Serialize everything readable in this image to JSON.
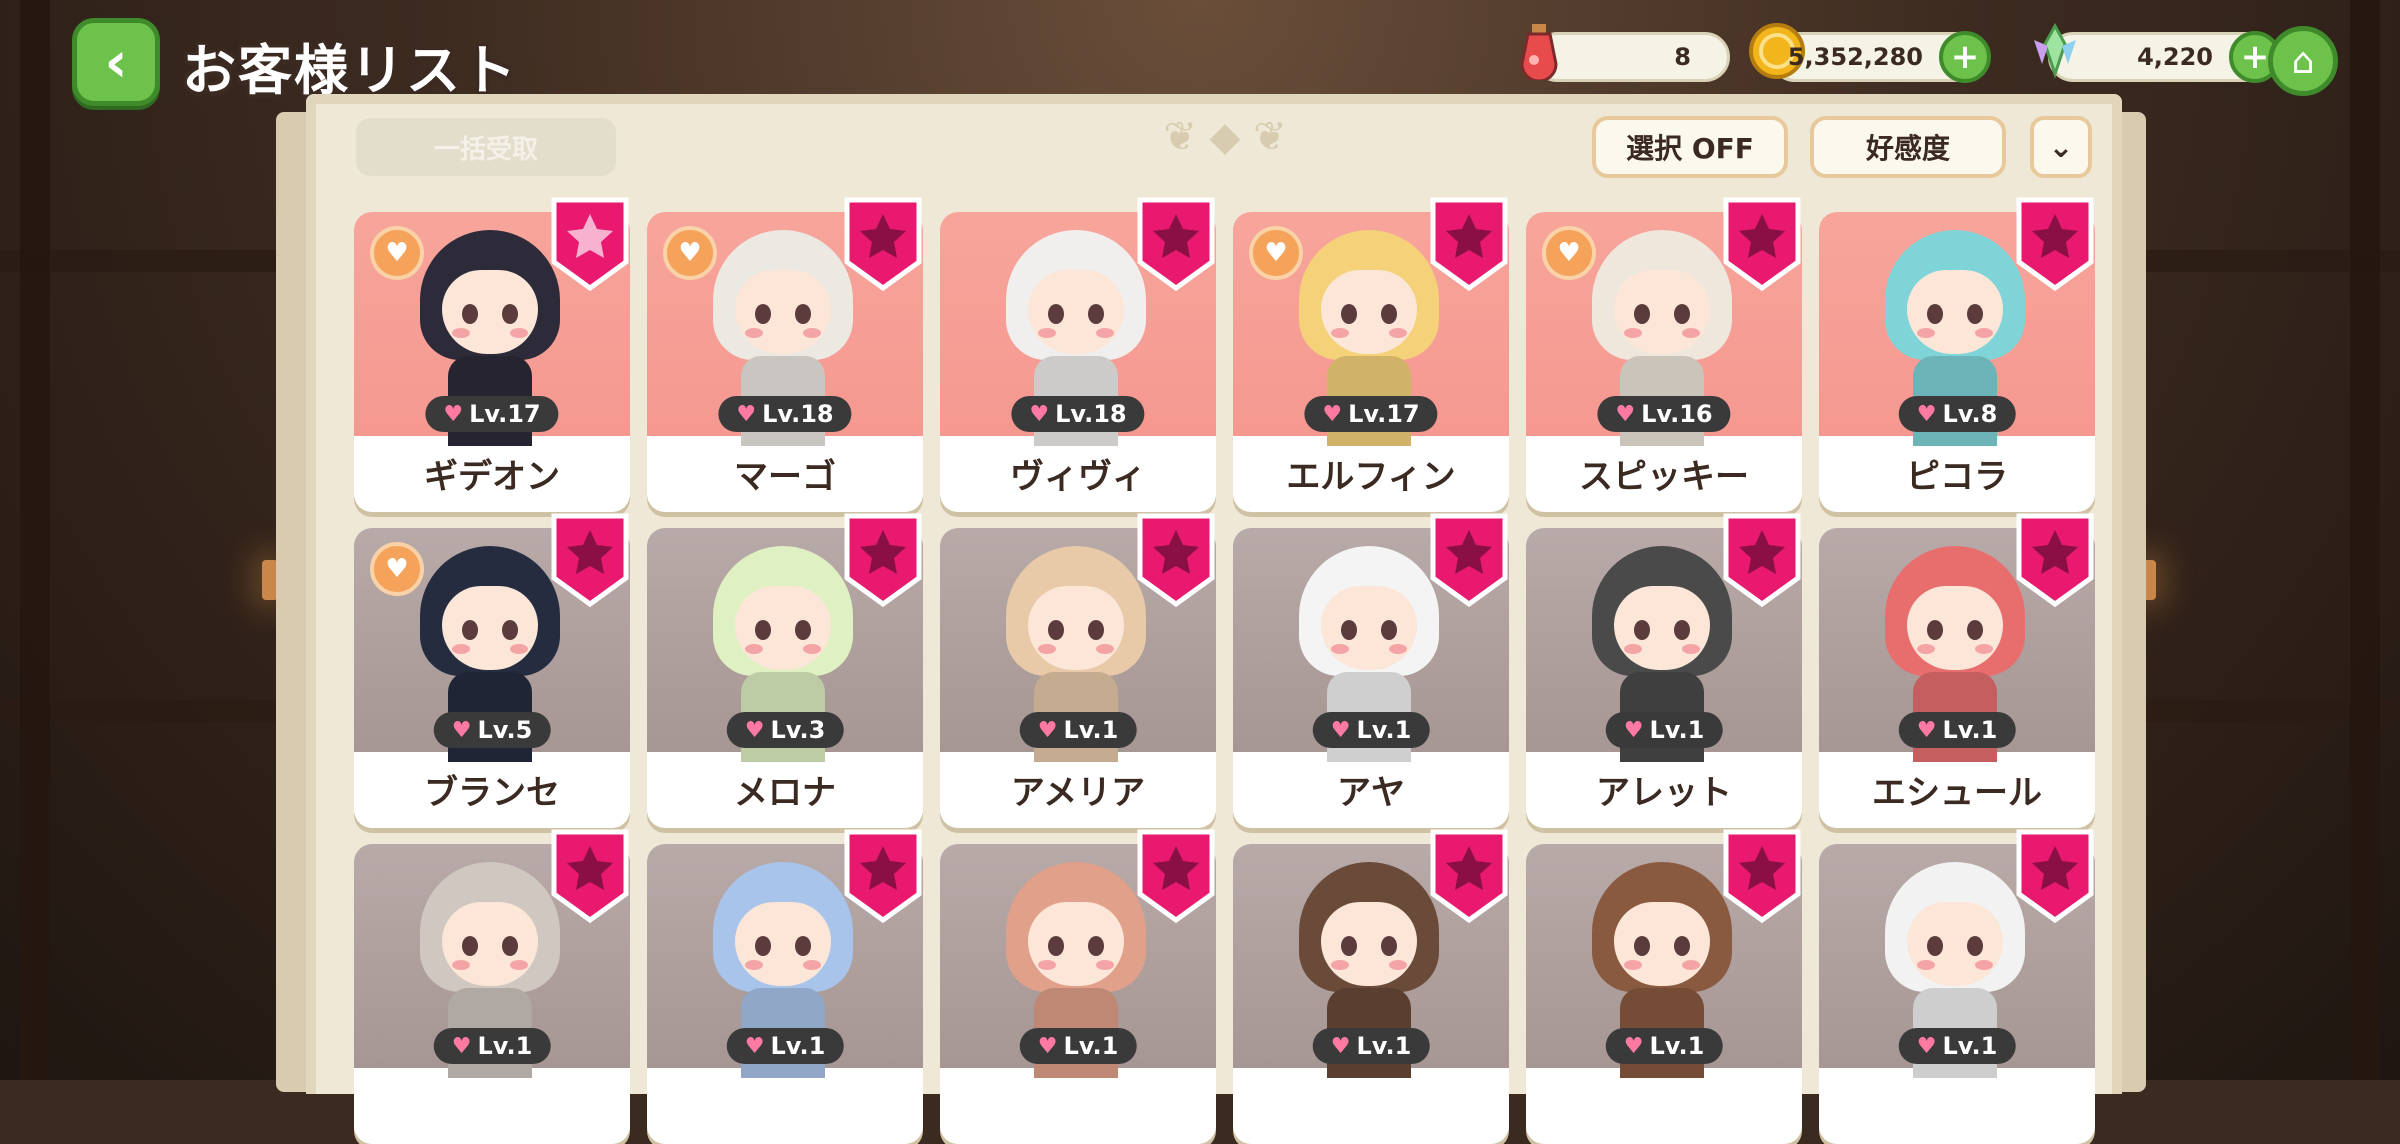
{
  "header": {
    "title": "お客様リスト",
    "resources": {
      "potion": {
        "value": "8",
        "icon": "potion-icon"
      },
      "coins": {
        "value": "5,352,280",
        "icon": "coin-icon"
      },
      "gems": {
        "value": "4,220",
        "icon": "crystal-icon"
      }
    }
  },
  "toolbar": {
    "bulk_receive": "一括受取",
    "select_toggle": "選択 OFF",
    "sort": "好感度"
  },
  "colors": {
    "accent_green": "#6cc24a",
    "badge_pink": "#e8196e",
    "card_pink": "#f7a59b",
    "card_gray": "#b0a09e"
  },
  "customers": [
    {
      "name": "ギデオン",
      "level": "Lv.17",
      "favorite": true,
      "unlocked": true,
      "badge_star": "light"
    },
    {
      "name": "マーゴ",
      "level": "Lv.18",
      "favorite": true,
      "unlocked": true,
      "badge_star": "dark"
    },
    {
      "name": "ヴィヴィ",
      "level": "Lv.18",
      "favorite": false,
      "unlocked": true,
      "badge_star": "dark"
    },
    {
      "name": "エルフィン",
      "level": "Lv.17",
      "favorite": true,
      "unlocked": true,
      "badge_star": "dark"
    },
    {
      "name": "スピッキー",
      "level": "Lv.16",
      "favorite": true,
      "unlocked": true,
      "badge_star": "dark"
    },
    {
      "name": "ピコラ",
      "level": "Lv.8",
      "favorite": false,
      "unlocked": true,
      "badge_star": "dark"
    },
    {
      "name": "ブランセ",
      "level": "Lv.5",
      "favorite": true,
      "unlocked": false,
      "badge_star": "dark"
    },
    {
      "name": "メロナ",
      "level": "Lv.3",
      "favorite": false,
      "unlocked": false,
      "badge_star": "dark"
    },
    {
      "name": "アメリア",
      "level": "Lv.1",
      "favorite": false,
      "unlocked": false,
      "badge_star": "dark"
    },
    {
      "name": "アヤ",
      "level": "Lv.1",
      "favorite": false,
      "unlocked": false,
      "badge_star": "dark"
    },
    {
      "name": "アレット",
      "level": "Lv.1",
      "favorite": false,
      "unlocked": false,
      "badge_star": "dark"
    },
    {
      "name": "エシュール",
      "level": "Lv.1",
      "favorite": false,
      "unlocked": false,
      "badge_star": "dark"
    },
    {
      "name": "",
      "level": "Lv.1",
      "favorite": false,
      "unlocked": false,
      "badge_star": "dark"
    },
    {
      "name": "",
      "level": "Lv.1",
      "favorite": false,
      "unlocked": false,
      "badge_star": "dark"
    },
    {
      "name": "",
      "level": "Lv.1",
      "favorite": false,
      "unlocked": false,
      "badge_star": "dark"
    },
    {
      "name": "",
      "level": "Lv.1",
      "favorite": false,
      "unlocked": false,
      "badge_star": "dark"
    },
    {
      "name": "",
      "level": "Lv.1",
      "favorite": false,
      "unlocked": false,
      "badge_star": "dark"
    },
    {
      "name": "",
      "level": "Lv.1",
      "favorite": false,
      "unlocked": false,
      "badge_star": "dark"
    }
  ]
}
